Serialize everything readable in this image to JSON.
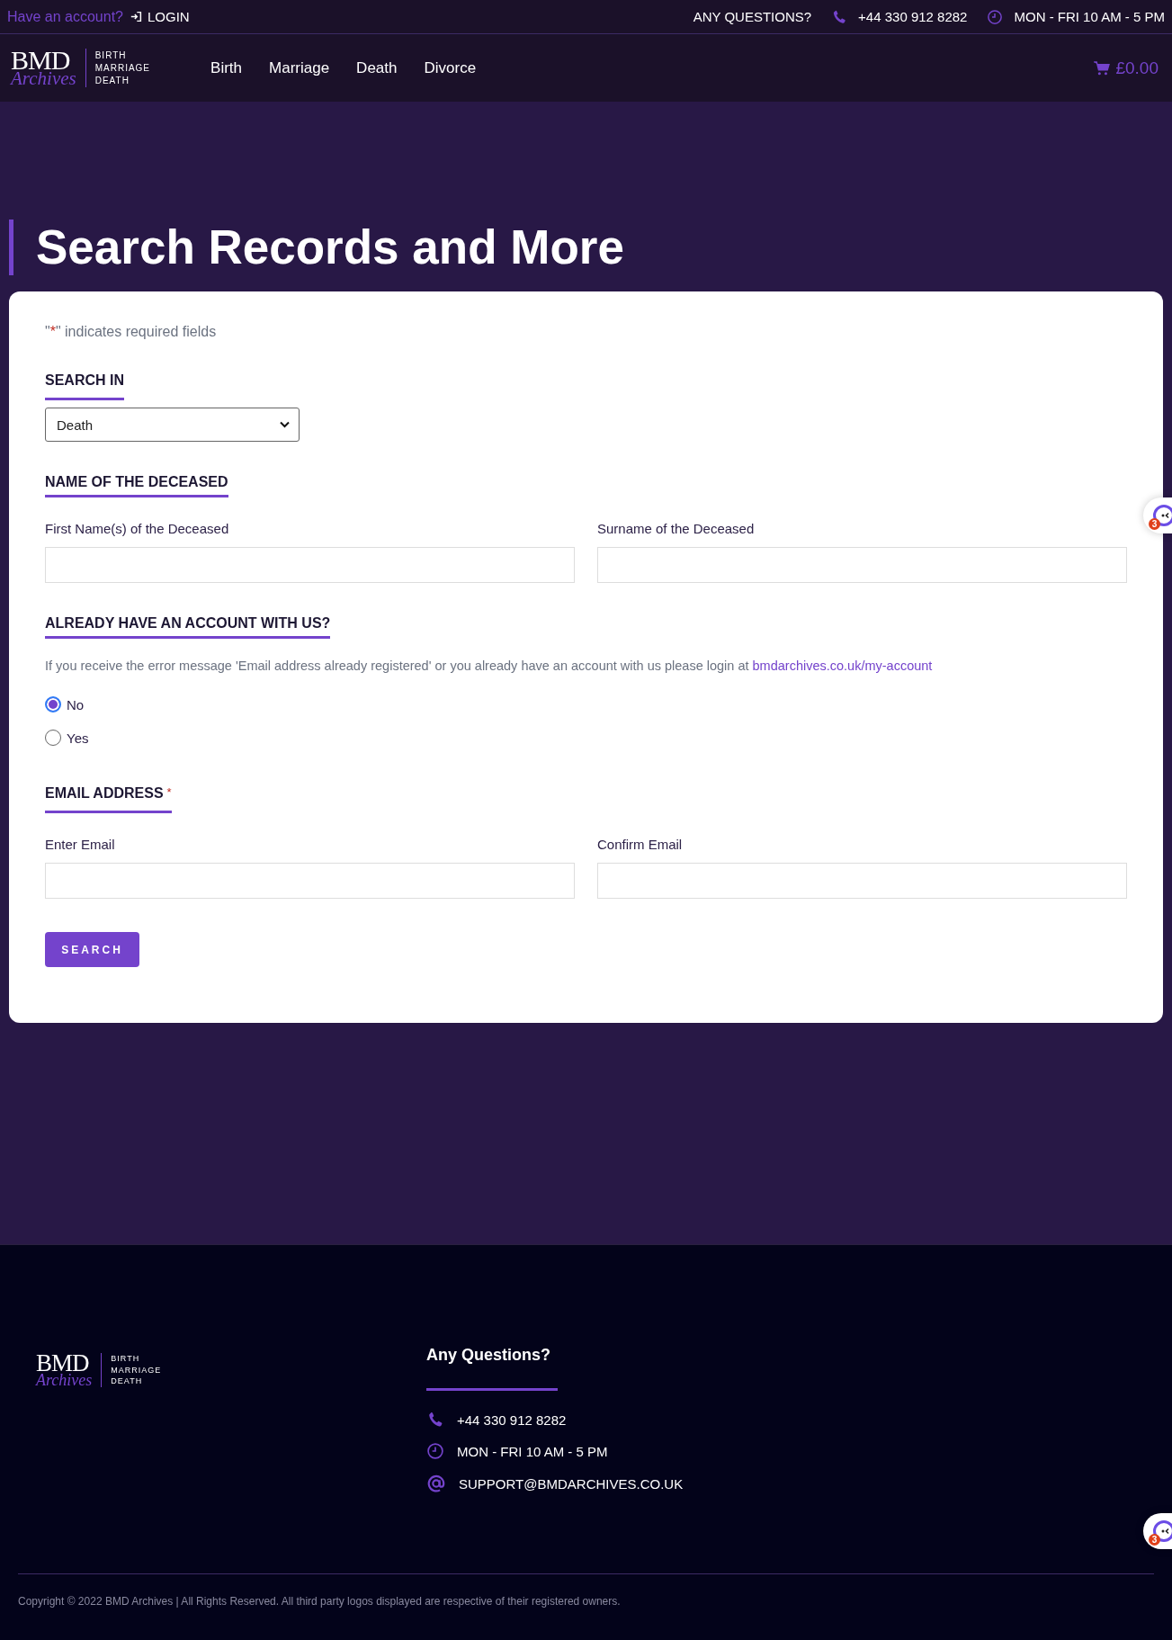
{
  "top_bar": {
    "account_prompt": "Have an account?",
    "login": "LOGIN",
    "questions": "ANY QUESTIONS?",
    "phone": "+44 330 912 8282",
    "hours": "MON - FRI 10 AM - 5 PM"
  },
  "header": {
    "logo": {
      "main": "BMD",
      "script": "Archives",
      "lines": [
        "BIRTH",
        "MARRIAGE",
        "DEATH"
      ]
    },
    "nav": [
      {
        "label": "Birth"
      },
      {
        "label": "Marriage"
      },
      {
        "label": "Death"
      },
      {
        "label": "Divorce"
      }
    ],
    "cart": "£0.00"
  },
  "page_title": "Search Records and More",
  "form": {
    "required_note": {
      "before": "\"",
      "mark": "*",
      "after": "\" indicates required fields"
    },
    "search_in": {
      "heading": "SEARCH IN",
      "value": "Death"
    },
    "name_section": {
      "heading": "NAME OF THE DECEASED",
      "fields": [
        {
          "label": "First Name(s) of the Deceased"
        },
        {
          "label": "Surname of the Deceased"
        }
      ]
    },
    "account_section": {
      "heading": "ALREADY HAVE AN ACCOUNT WITH US?",
      "message": "If you receive the error message 'Email address already registered' or you already have an account with us please login at",
      "link": "bmdarchives.co.uk/my-account",
      "options": [
        {
          "label": "No",
          "selected": true
        },
        {
          "label": "Yes",
          "selected": false
        }
      ]
    },
    "email_section": {
      "heading": "EMAIL ADDRESS",
      "required_mark": "*",
      "fields": [
        {
          "label": "Enter Email"
        },
        {
          "label": "Confirm Email"
        }
      ]
    },
    "submit": "SEARCH"
  },
  "chat_widgets": [
    {
      "badge": "3"
    },
    {
      "badge": "3"
    }
  ],
  "footer": {
    "logo": {
      "main": "BMD",
      "script": "Archives",
      "lines": [
        "BIRTH",
        "MARRIAGE",
        "DEATH"
      ]
    },
    "heading": "Any Questions?",
    "contacts": [
      {
        "kind": "phone",
        "text": "+44 330 912 8282"
      },
      {
        "kind": "hours",
        "text": "MON - FRI 10 AM - 5 PM"
      },
      {
        "kind": "email",
        "text": "SUPPORT@BMDARCHIVES.CO.UK"
      }
    ],
    "copyright": "Copyright © 2022 BMD Archives | All Rights Reserved. All third party logos displayed are respective of their registered owners."
  }
}
